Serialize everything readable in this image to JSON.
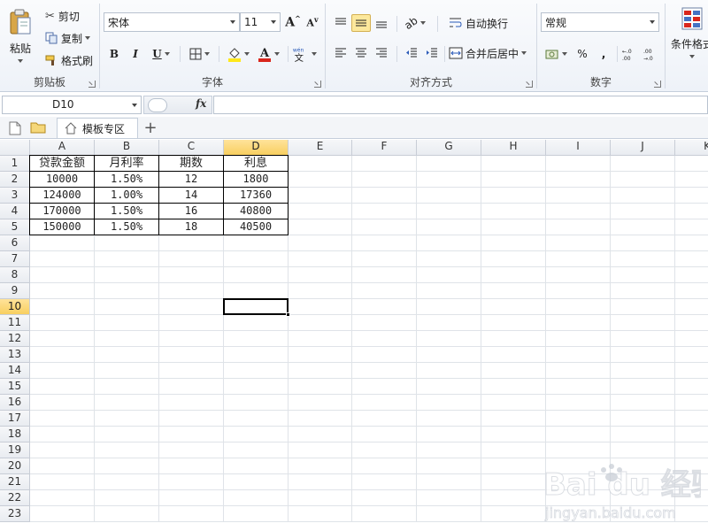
{
  "ribbon": {
    "clipboard": {
      "paste_label": "粘贴",
      "cut_label": "剪切",
      "copy_label": "复制",
      "format_painter_label": "格式刷",
      "group_label": "剪贴板"
    },
    "font": {
      "font_name": "宋体",
      "font_size": "11",
      "bold": "B",
      "italic": "I",
      "underline": "U",
      "group_label": "字体",
      "font_color": "#d9261c",
      "fill_color": "#ffe81a"
    },
    "alignment": {
      "wrap_text_label": "自动换行",
      "merge_center_label": "合并后居中",
      "group_label": "对齐方式"
    },
    "number": {
      "format_value": "常规",
      "percent": "%",
      "comma": ",",
      "group_label": "数字"
    },
    "styles": {
      "conditional_format_label": "条件格式"
    }
  },
  "formula_bar": {
    "name_box": "D10",
    "fx": "fx",
    "formula": ""
  },
  "tabs": {
    "sheet_tab_label": "模板专区",
    "add_label": "+"
  },
  "sheet": {
    "columns": [
      "A",
      "B",
      "C",
      "D",
      "E",
      "F",
      "G",
      "H",
      "I",
      "J",
      "K"
    ],
    "selected_column": "D",
    "rows": [
      "1",
      "2",
      "3",
      "4",
      "5",
      "6",
      "7",
      "8",
      "9",
      "10",
      "11",
      "12",
      "13",
      "14",
      "15",
      "16",
      "17",
      "18",
      "19",
      "20",
      "21",
      "22",
      "23"
    ],
    "selected_row": "10",
    "active_cell": "D10",
    "table": {
      "headers": [
        "贷款金额",
        "月利率",
        "期数",
        "利息"
      ],
      "data": [
        [
          "10000",
          "1.50%",
          "12",
          "1800"
        ],
        [
          "124000",
          "1.00%",
          "14",
          "17360"
        ],
        [
          "170000",
          "1.50%",
          "16",
          "40800"
        ],
        [
          "150000",
          "1.50%",
          "18",
          "40500"
        ]
      ]
    }
  },
  "watermark": {
    "brand": "Bai du 经验",
    "url": "jingyan.baidu.com"
  },
  "colors": {
    "selected_header": "#f8cf60",
    "grid_line": "#dfe3e8",
    "ribbon_bg": "#eef2f8"
  }
}
